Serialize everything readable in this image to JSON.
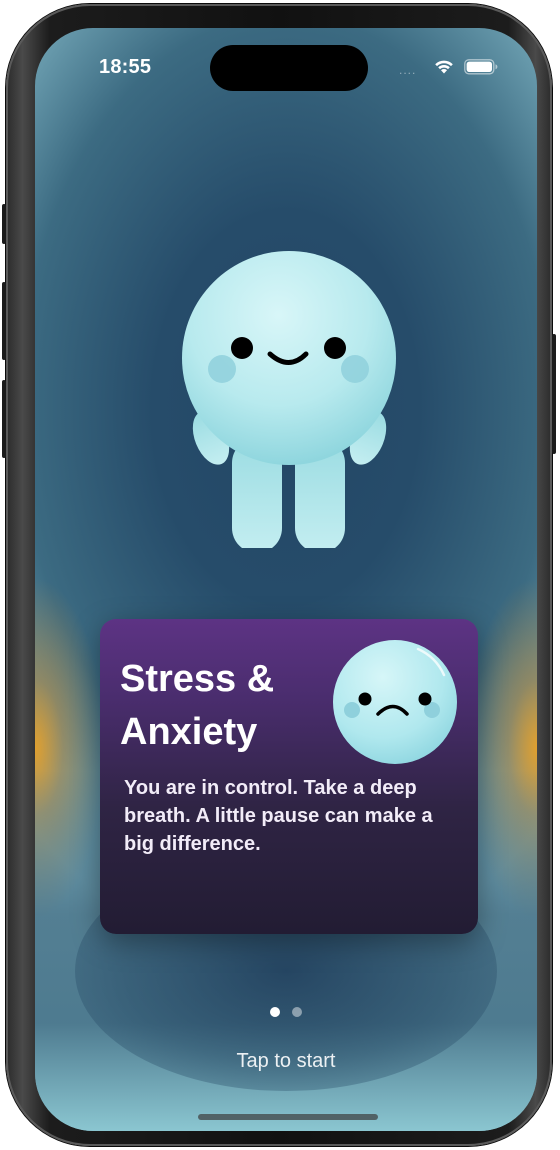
{
  "status_bar": {
    "time": "18:55",
    "signal": "....",
    "wifi_icon": "wifi-icon",
    "battery_icon": "battery-icon"
  },
  "mascot": {
    "icon": "smiling-blob-mascot"
  },
  "card": {
    "title": "Stress &\nAnxiety",
    "body": "You are in control. Take a deep breath. A little pause can make a big difference.",
    "icon": "worried-face-icon"
  },
  "pager": {
    "count": 2,
    "active_index": 0
  },
  "footer": {
    "tap_label": "Tap to start"
  },
  "colors": {
    "background": "#264c6a",
    "card_top": "#5d3384",
    "card_bottom": "#221c33",
    "mascot": "#b8ecf0",
    "side_glow": "#e6a028"
  }
}
